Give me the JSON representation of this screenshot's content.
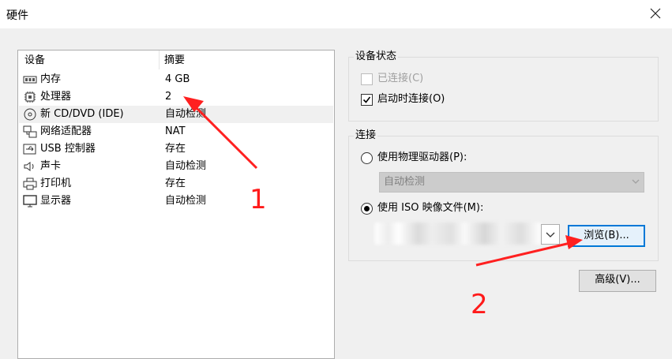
{
  "window": {
    "title": "硬件"
  },
  "device_list": {
    "headers": {
      "device": "设备",
      "summary": "摘要"
    },
    "rows": [
      {
        "name": "内存",
        "summary": "4 GB",
        "icon": "memory-icon"
      },
      {
        "name": "处理器",
        "summary": "2",
        "icon": "cpu-icon"
      },
      {
        "name": "新 CD/DVD (IDE)",
        "summary": "自动检测",
        "icon": "cd-dvd-icon",
        "selected": true
      },
      {
        "name": "网络适配器",
        "summary": "NAT",
        "icon": "network-adapter-icon"
      },
      {
        "name": "USB 控制器",
        "summary": "存在",
        "icon": "usb-icon"
      },
      {
        "name": "声卡",
        "summary": "自动检测",
        "icon": "sound-card-icon"
      },
      {
        "name": "打印机",
        "summary": "存在",
        "icon": "printer-icon"
      },
      {
        "name": "显示器",
        "summary": "自动检测",
        "icon": "monitor-icon"
      }
    ]
  },
  "device_status": {
    "legend": "设备状态",
    "connected": {
      "label": "已连接(C)",
      "checked": false,
      "disabled": true
    },
    "connect_at_power_on": {
      "label": "启动时连接(O)",
      "checked": true
    }
  },
  "connection": {
    "legend": "连接",
    "physical_drive": {
      "label": "使用物理驱动器(P):",
      "selected": false,
      "dropdown_value": "自动检测"
    },
    "iso_image": {
      "label": "使用 ISO 映像文件(M):",
      "selected": true
    }
  },
  "buttons": {
    "browse": "浏览(B)...",
    "advanced": "高级(V)..."
  },
  "annotations": {
    "arrow1_label": "1",
    "arrow2_label": "2",
    "color": "#ff1a1a"
  }
}
